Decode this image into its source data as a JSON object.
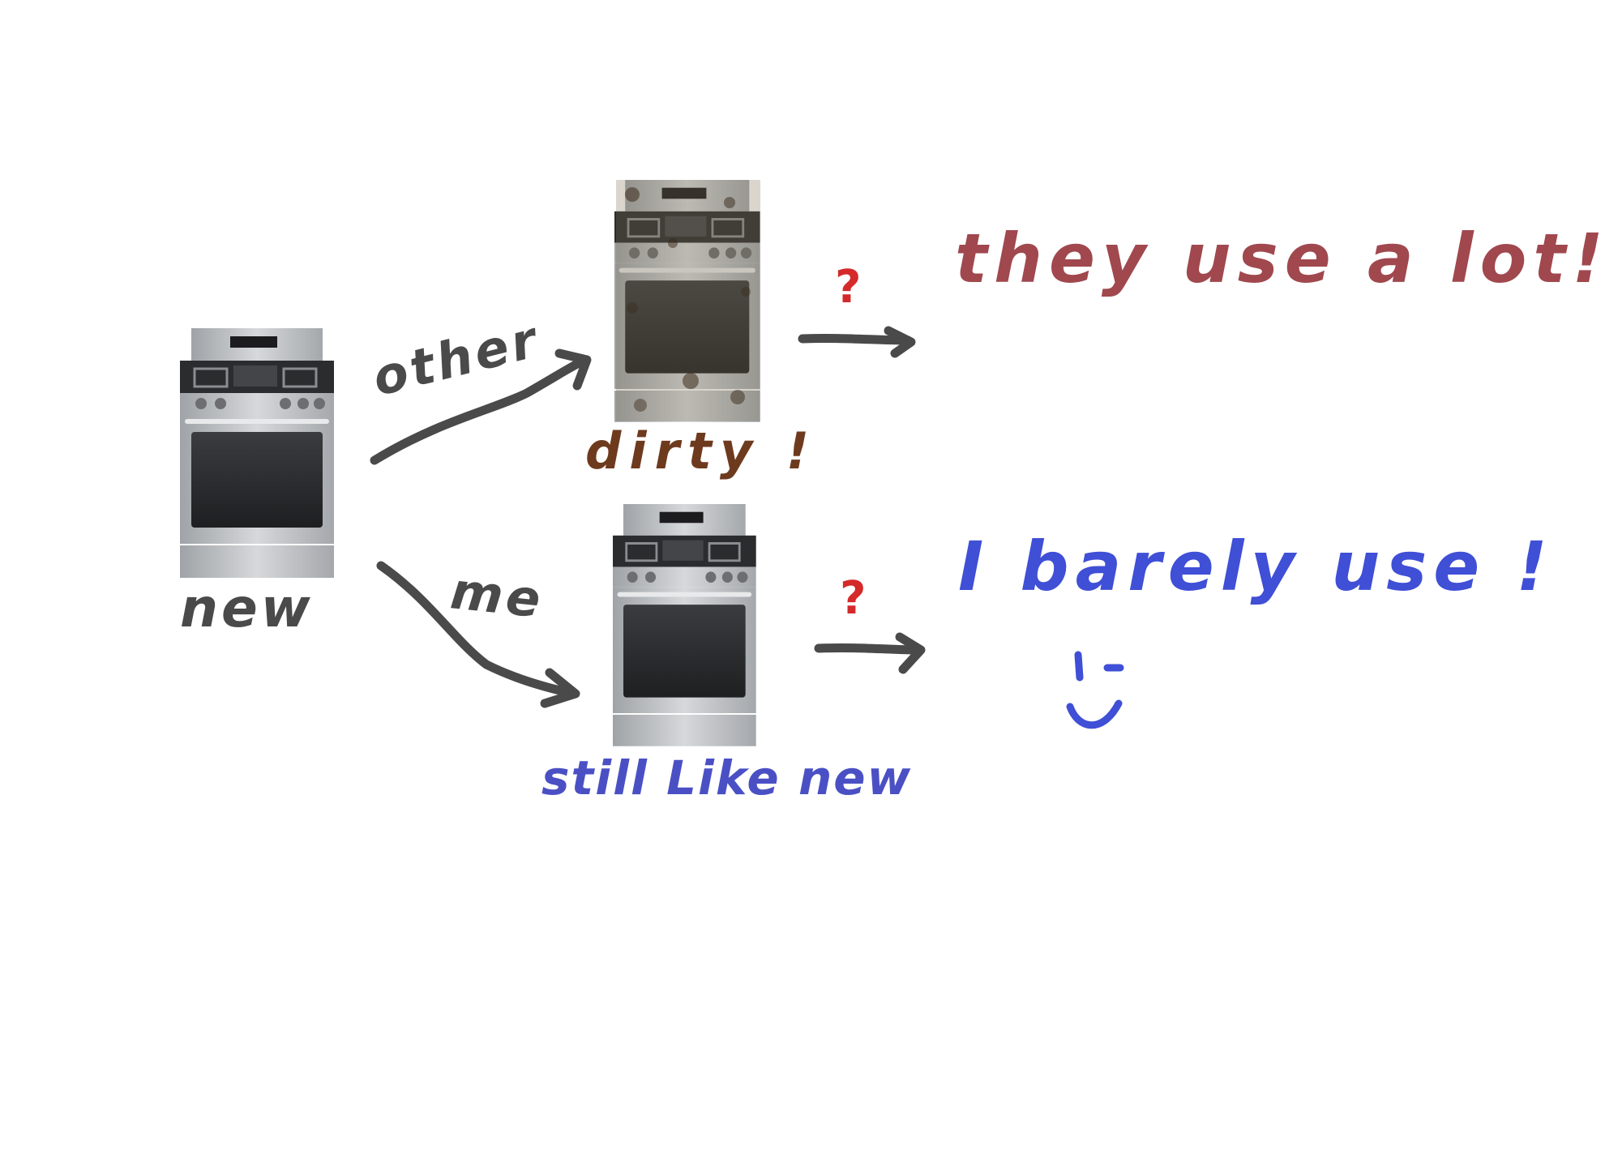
{
  "labels": {
    "new": "new",
    "other": "other",
    "me": "me",
    "dirty": "dirty !",
    "still_like_new": "still Like new",
    "they_use_a_lot": "they use a lot!",
    "i_barely_use": "I barely use !",
    "question_top": "?",
    "question_bottom": "?"
  },
  "colors": {
    "ink": "#4a4a4a",
    "dirty_brown": "#6e3a1e",
    "blue": "#3f4fd6",
    "still_blue": "#4a50c4",
    "red_brown": "#a0484e",
    "question_red": "#d42a2a",
    "steel": "#b9bcc0"
  },
  "icons": [
    "stove-new-icon",
    "stove-dirty-icon",
    "stove-clean-icon",
    "smiley-icon"
  ]
}
